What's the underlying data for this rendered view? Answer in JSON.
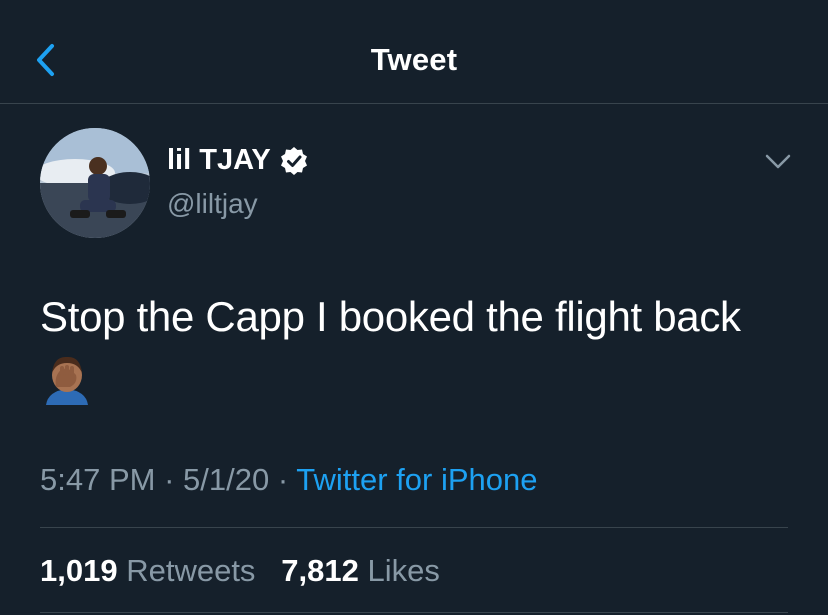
{
  "header": {
    "title": "Tweet",
    "back_icon": "chevron-left-icon",
    "accent_color": "#1da1f2"
  },
  "author": {
    "display_name": "lil TJAY",
    "handle": "@liltjay",
    "verified": true,
    "verified_icon": "verified-badge-icon"
  },
  "tweet": {
    "text": "Stop the Capp I booked the flight back",
    "emoji": "face-palm-emoji",
    "time": "5:47 PM",
    "date": "5/1/20",
    "source": "Twitter for iPhone",
    "dot_separator": "·"
  },
  "stats": {
    "retweets_count": "1,019",
    "retweets_label": "Retweets",
    "likes_count": "7,812",
    "likes_label": "Likes"
  },
  "colors": {
    "background": "#15202b",
    "secondary_text": "#8899a6",
    "divider": "#38444d"
  }
}
